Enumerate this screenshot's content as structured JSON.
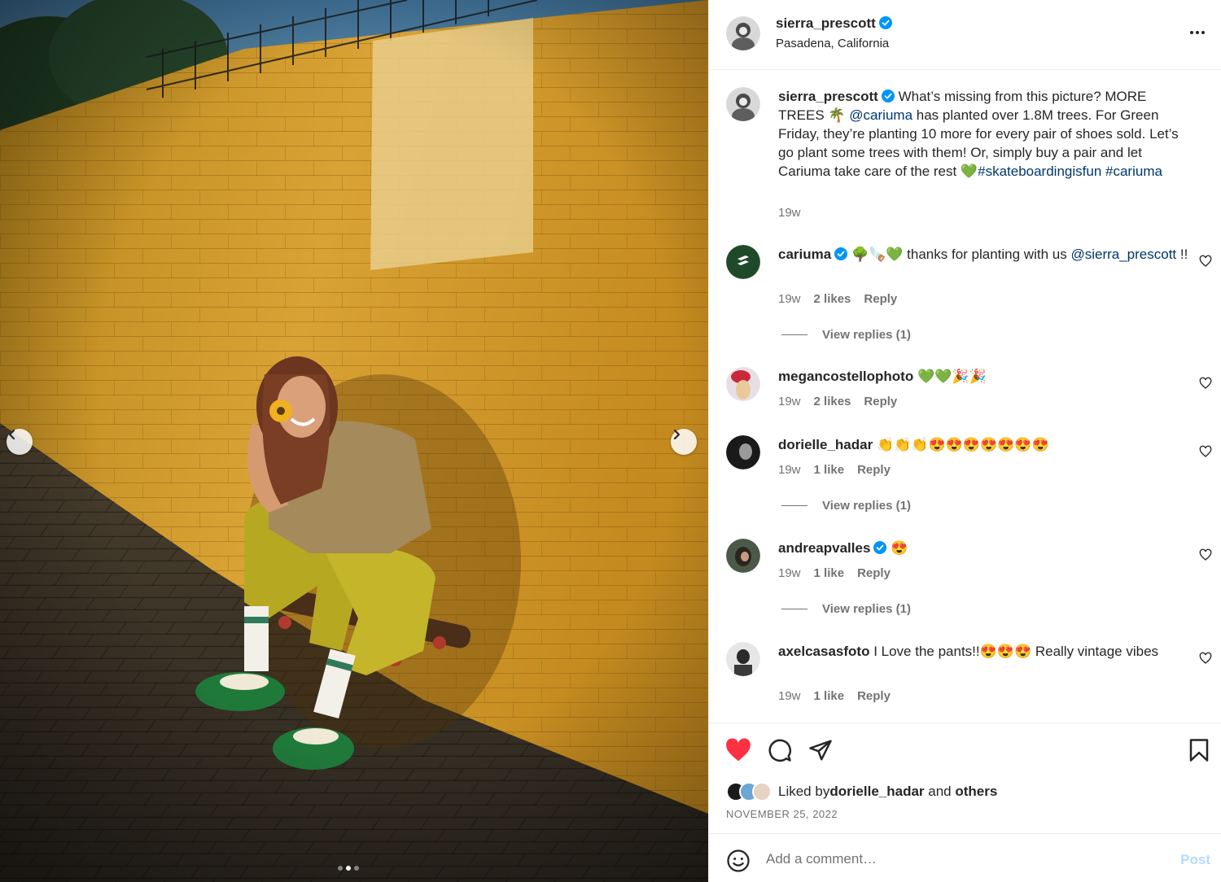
{
  "post": {
    "author": "sierra_prescott",
    "location": "Pasadena, California",
    "verified": true
  },
  "caption": {
    "username": "sierra_prescott",
    "text_1": "What’s missing from this picture? MORE TREES 🌴 ",
    "mention": "@cariuma",
    "text_2": " has planted over 1.8M trees. For Green Friday, they’re planting 10 more for every pair of shoes sold. Let’s go plant some trees with them! Or, simply buy a pair and let Cariuma take care of the rest 💚",
    "hashtag_1": "#skateboardingisfun",
    "hashtag_2": "#cariuma",
    "time": "19w"
  },
  "comments": [
    {
      "username": "cariuma",
      "text_1": "🌳🪚💚 thanks for planting with us ",
      "mention": "@sierra_prescott",
      "text_2": " !!",
      "time": "19w",
      "likes": "2 likes",
      "reply": "Reply",
      "view_replies": "View replies (1)"
    },
    {
      "username": "megancostellophoto",
      "text": "💚💚🎉🎉",
      "time": "19w",
      "likes": "2 likes",
      "reply": "Reply"
    },
    {
      "username": "dorielle_hadar",
      "text": "👏👏👏😍😍😍😍😍😍😍",
      "time": "19w",
      "likes": "1 like",
      "reply": "Reply",
      "view_replies": "View replies (1)"
    },
    {
      "username": "andreapvalles",
      "text": "😍",
      "time": "19w",
      "likes": "1 like",
      "reply": "Reply",
      "view_replies": "View replies (1)"
    },
    {
      "username": "axelcasasfoto",
      "text": "I Love the pants!!😍😍😍 Really vintage vibes",
      "time": "19w",
      "likes": "1 like",
      "reply": "Reply"
    }
  ],
  "likes_summary": {
    "prefix": "Liked by ",
    "user": "dorielle_hadar",
    "middle": " and ",
    "others": "others"
  },
  "date": "NOVEMBER 25, 2022",
  "add_comment": {
    "placeholder": "Add a comment…",
    "post_label": "Post"
  },
  "carousel": {
    "count": 3,
    "active": 2
  },
  "colors": {
    "verified": "#0095f6",
    "like_red": "#ff3040",
    "link": "#00376b",
    "muted": "#737373",
    "post_disabled": "#b3dbff"
  }
}
